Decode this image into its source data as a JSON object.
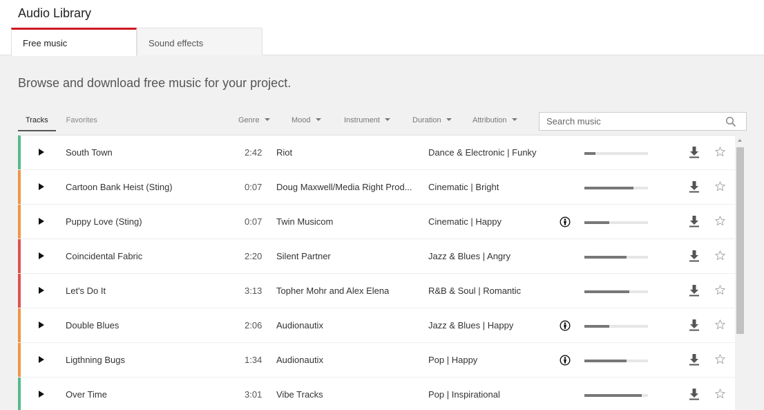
{
  "app": {
    "title": "Audio Library"
  },
  "tabs": [
    {
      "label": "Free music",
      "active": true
    },
    {
      "label": "Sound effects",
      "active": false
    }
  ],
  "tagline": "Browse and download free music for your project.",
  "subtabs": [
    {
      "label": "Tracks",
      "active": true
    },
    {
      "label": "Favorites",
      "active": false
    }
  ],
  "filters": {
    "genre": "Genre",
    "mood": "Mood",
    "instrument": "Instrument",
    "duration": "Duration",
    "attribution": "Attribution"
  },
  "search": {
    "placeholder": "Search music",
    "value": ""
  },
  "colors": {
    "green": "#57bb8a",
    "orange": "#f0954a",
    "red": "#e0524f",
    "accent": "#cc181e"
  },
  "tracks": [
    {
      "title": "South Town",
      "duration": "2:42",
      "artist": "Riot",
      "genre": "Dance & Electronic | Funky",
      "attribution": false,
      "popularity": 0.17,
      "mood_color": "green"
    },
    {
      "title": "Cartoon Bank Heist (Sting)",
      "duration": "0:07",
      "artist": "Doug Maxwell/Media Right Prod...",
      "genre": "Cinematic | Bright",
      "attribution": false,
      "popularity": 0.77,
      "mood_color": "orange"
    },
    {
      "title": "Puppy Love (Sting)",
      "duration": "0:07",
      "artist": "Twin Musicom",
      "genre": "Cinematic | Happy",
      "attribution": true,
      "popularity": 0.39,
      "mood_color": "orange"
    },
    {
      "title": "Coincidental Fabric",
      "duration": "2:20",
      "artist": "Silent Partner",
      "genre": "Jazz & Blues | Angry",
      "attribution": false,
      "popularity": 0.66,
      "mood_color": "red"
    },
    {
      "title": "Let's Do It",
      "duration": "3:13",
      "artist": "Topher Mohr and Alex Elena",
      "genre": "R&B & Soul | Romantic",
      "attribution": false,
      "popularity": 0.71,
      "mood_color": "red"
    },
    {
      "title": "Double Blues",
      "duration": "2:06",
      "artist": "Audionautix",
      "genre": "Jazz & Blues | Happy",
      "attribution": true,
      "popularity": 0.39,
      "mood_color": "orange"
    },
    {
      "title": "Ligthning Bugs",
      "duration": "1:34",
      "artist": "Audionautix",
      "genre": "Pop | Happy",
      "attribution": true,
      "popularity": 0.66,
      "mood_color": "orange"
    },
    {
      "title": "Over Time",
      "duration": "3:01",
      "artist": "Vibe Tracks",
      "genre": "Pop | Inspirational",
      "attribution": false,
      "popularity": 0.9,
      "mood_color": "green"
    }
  ]
}
